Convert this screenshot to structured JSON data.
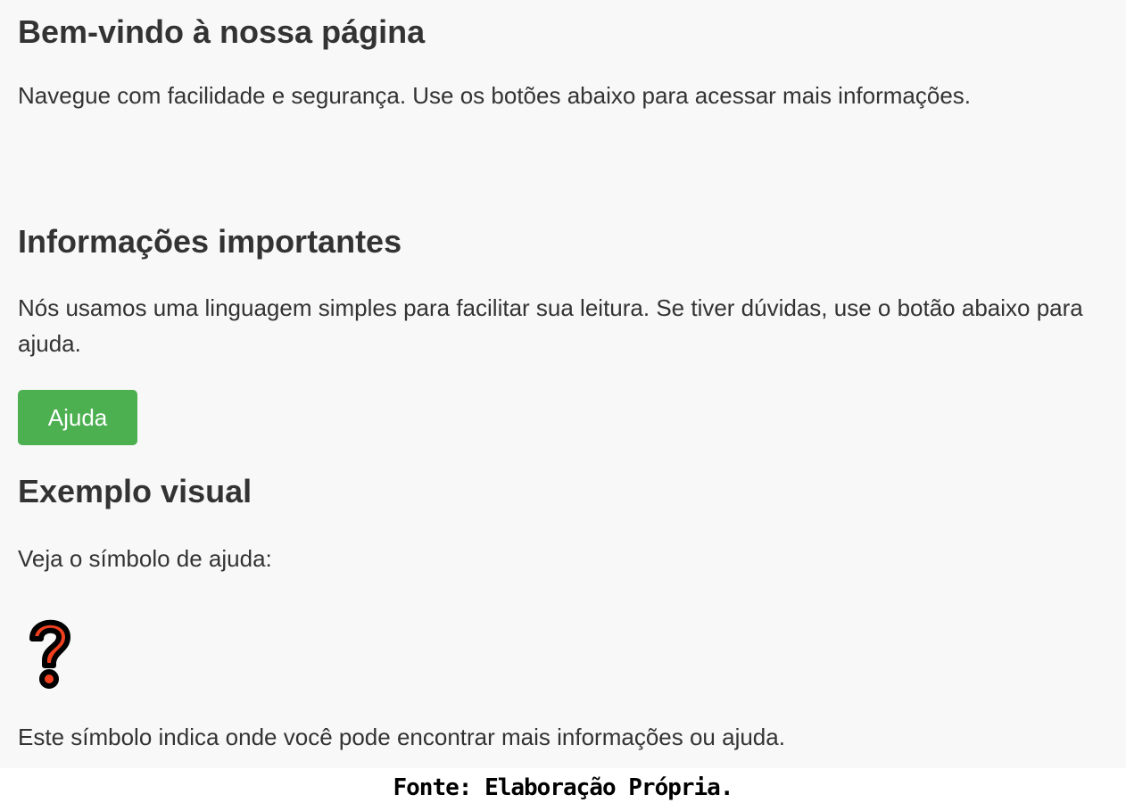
{
  "sections": {
    "welcome": {
      "heading": "Bem-vindo à nossa página",
      "text": "Navegue com facilidade e segurança. Use os botões abaixo para acessar mais informações."
    },
    "info": {
      "heading": "Informações importantes",
      "text": "Nós usamos uma linguagem simples para facilitar sua leitura. Se tiver dúvidas, use o botão abaixo para ajuda.",
      "button_label": "Ajuda"
    },
    "example": {
      "heading": "Exemplo visual",
      "text": "Veja o símbolo de ajuda:",
      "icon": "question-mark-icon",
      "symbol_text": "Este símbolo indica onde você pode encontrar mais informações ou ajuda."
    }
  },
  "caption": "Fonte: Elaboração Própria.",
  "colors": {
    "background": "#f8f8f8",
    "text": "#333333",
    "button": "#4caf50",
    "button_text": "#ffffff",
    "icon_fill": "#f0401f",
    "icon_outline": "#000000"
  }
}
